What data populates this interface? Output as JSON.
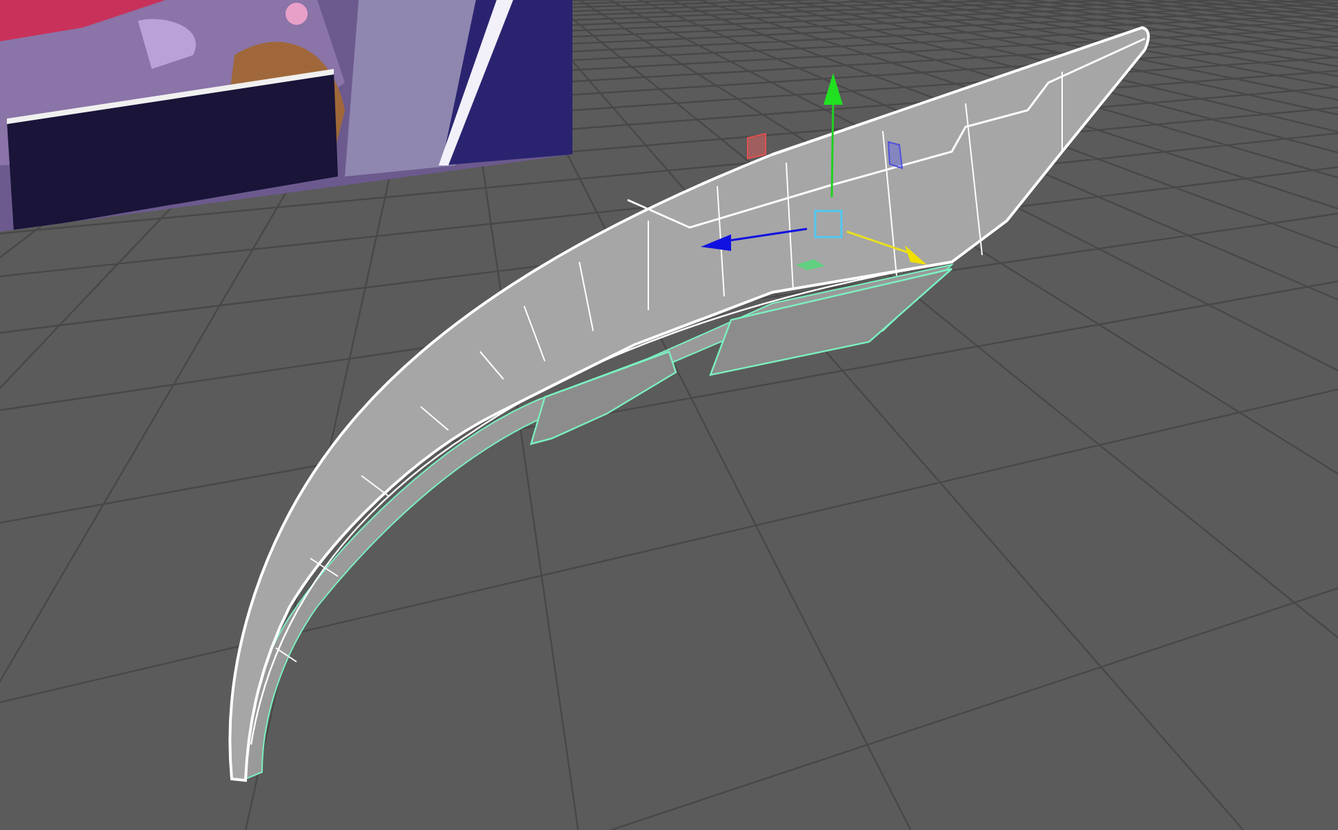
{
  "viewport": {
    "mesh": {
      "kind": "blade"
    },
    "manipulator": {
      "kind": "move"
    }
  }
}
